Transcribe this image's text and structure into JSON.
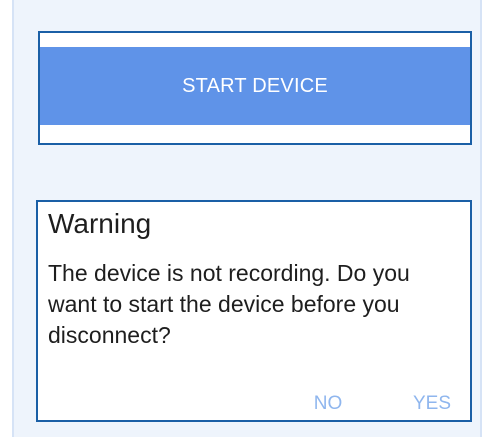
{
  "start_device": {
    "label": "START DEVICE"
  },
  "dialog": {
    "title": "Warning",
    "message": "The device is not recording. Do you want to start the device before you disconnect?",
    "buttons": {
      "no": "NO",
      "yes": "YES"
    }
  },
  "colors": {
    "accent": "#5f93e8",
    "border": "#1a5fa6",
    "panel_background": "#eef4fc",
    "dialog_button_text": "#8fb6ee"
  }
}
